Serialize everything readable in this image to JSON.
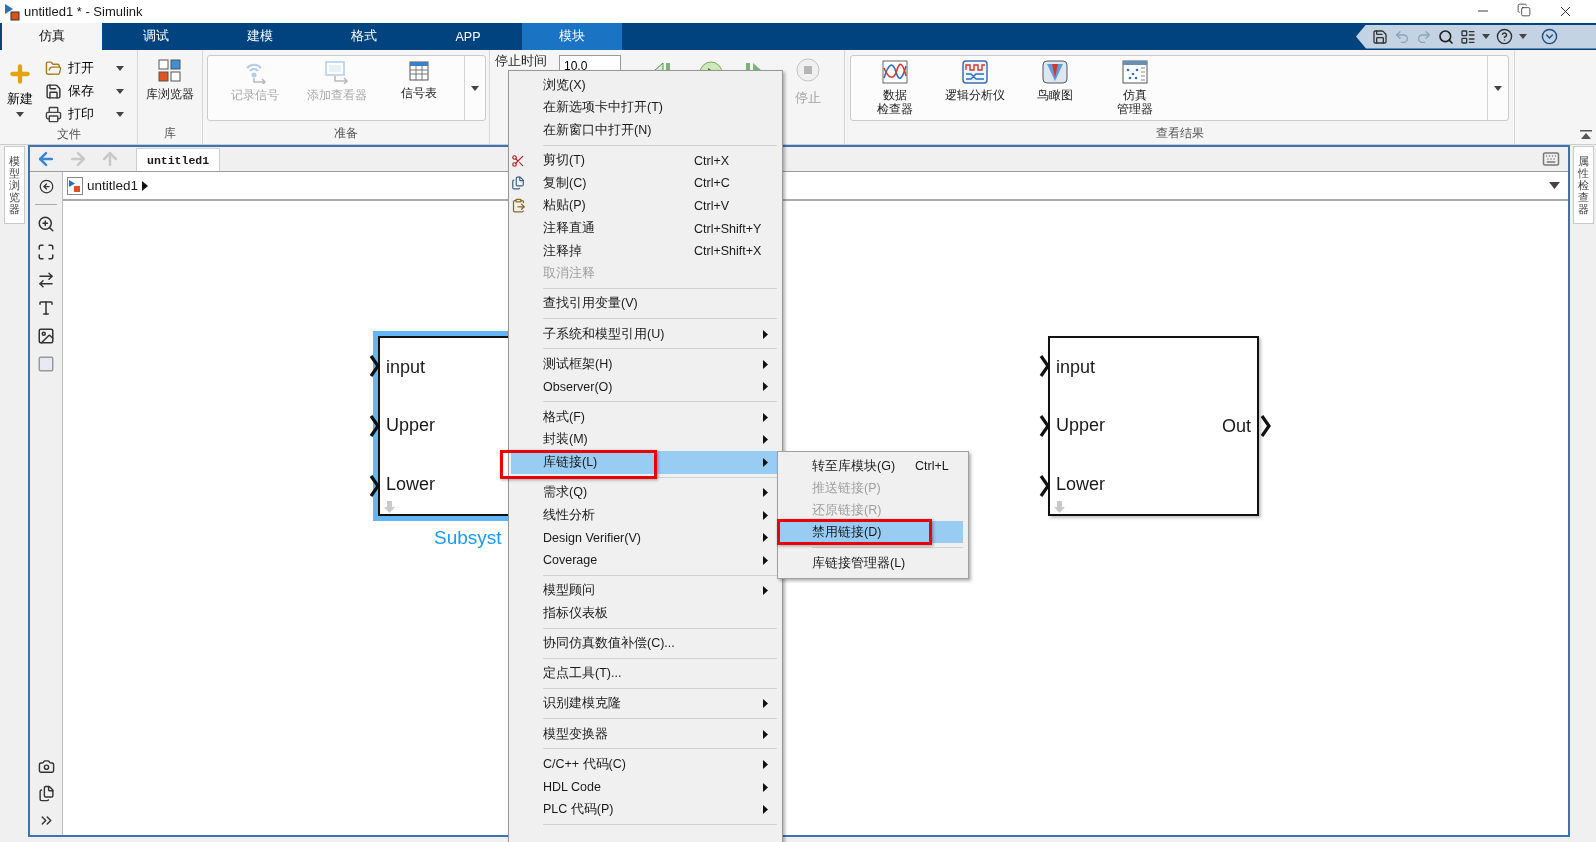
{
  "window": {
    "title": "untitled1 * - Simulink"
  },
  "ribbon_tabs": [
    {
      "label": "仿真",
      "selected": true,
      "kind": "standard"
    },
    {
      "label": "调试",
      "selected": false,
      "kind": "standard"
    },
    {
      "label": "建模",
      "selected": false,
      "kind": "standard"
    },
    {
      "label": "格式",
      "selected": false,
      "kind": "standard"
    },
    {
      "label": "APP",
      "selected": false,
      "kind": "standard"
    },
    {
      "label": "模块",
      "selected": false,
      "kind": "contextual"
    }
  ],
  "ribbon": {
    "file": {
      "title": "文件",
      "new": "新建",
      "items": [
        {
          "kind": "open",
          "label": "打开"
        },
        {
          "kind": "save",
          "label": "保存"
        },
        {
          "kind": "print",
          "label": "打印"
        }
      ]
    },
    "library": {
      "title": "库",
      "buttons": [
        {
          "kind": "library",
          "label_lines": [
            "库浏览器"
          ],
          "disabled": false
        }
      ]
    },
    "prepare": {
      "title": "准备",
      "buttons": [
        {
          "kind": "log",
          "label_lines": [
            "记录信号"
          ],
          "disabled": true
        },
        {
          "kind": "viewer",
          "label_lines": [
            "添加查看器"
          ],
          "disabled": true
        },
        {
          "kind": "table",
          "label_lines": [
            "信号表"
          ],
          "disabled": false
        }
      ]
    },
    "simulate": {
      "stop_time_label": "停止时间",
      "stop_time": "10.0",
      "stop_label": "停止",
      "stop_disabled": true
    },
    "results": {
      "title": "查看结果",
      "buttons": [
        {
          "kind": "inspector",
          "label_lines": [
            "数据",
            "检查器"
          ],
          "disabled": false
        },
        {
          "kind": "logic",
          "label_lines": [
            "逻辑分析仪"
          ],
          "disabled": false
        },
        {
          "kind": "birdseye",
          "label_lines": [
            "鸟瞰图"
          ],
          "disabled": false
        },
        {
          "kind": "manager",
          "label_lines": [
            "仿真",
            "管理器"
          ],
          "disabled": false
        }
      ]
    }
  },
  "editor": {
    "model_browser_tab": "模型浏览器",
    "property_inspector_tab": "属性检查器",
    "tab": {
      "label": "untitled1",
      "selected": true
    },
    "breadcrumb": "untitled1"
  },
  "blocks": [
    {
      "selected": true,
      "name": "Subsyst",
      "inputs": [
        "input",
        "Upper",
        "Lower"
      ]
    },
    {
      "selected": false,
      "inputs": [
        "input",
        "Upper",
        "Lower"
      ],
      "outputs": [
        "Out"
      ]
    }
  ],
  "context_menu": {
    "groups": [
      [
        {
          "kind": "plain",
          "label": "浏览(X)",
          "arrow": false,
          "disabled": false,
          "selected": false
        },
        {
          "kind": "plain",
          "label": "在新选项卡中打开(T)",
          "arrow": false,
          "disabled": false,
          "selected": false
        },
        {
          "kind": "plain",
          "label": "在新窗口中打开(N)",
          "arrow": false,
          "disabled": false,
          "selected": false
        }
      ],
      [
        {
          "kind": "cut",
          "label": "剪切(T)",
          "shortcut": "Ctrl+X",
          "arrow": false,
          "disabled": false,
          "selected": false
        },
        {
          "kind": "copy",
          "label": "复制(C)",
          "shortcut": "Ctrl+C",
          "arrow": false,
          "disabled": false,
          "selected": false
        },
        {
          "kind": "paste",
          "label": "粘贴(P)",
          "shortcut": "Ctrl+V",
          "arrow": false,
          "disabled": false,
          "selected": false
        },
        {
          "kind": "plain",
          "label": "注释直通",
          "shortcut": "Ctrl+Shift+Y",
          "arrow": false,
          "disabled": false,
          "selected": false
        },
        {
          "kind": "plain",
          "label": "注释掉",
          "shortcut": "Ctrl+Shift+X",
          "arrow": false,
          "disabled": false,
          "selected": false
        },
        {
          "kind": "plain",
          "label": "取消注释",
          "arrow": false,
          "disabled": true,
          "selected": false
        }
      ],
      [
        {
          "kind": "plain",
          "label": "查找引用变量(V)",
          "arrow": false,
          "disabled": false,
          "selected": false
        }
      ],
      [
        {
          "kind": "plain",
          "label": "子系统和模型引用(U)",
          "arrow": true,
          "disabled": false,
          "selected": false
        }
      ],
      [
        {
          "kind": "plain",
          "label": "测试框架(H)",
          "arrow": true,
          "disabled": false,
          "selected": false
        },
        {
          "kind": "plain",
          "label": "Observer(O)",
          "arrow": true,
          "disabled": false,
          "selected": false
        }
      ],
      [
        {
          "kind": "plain",
          "label": "格式(F)",
          "arrow": true,
          "disabled": false,
          "selected": false
        },
        {
          "kind": "plain",
          "label": "封装(M)",
          "arrow": true,
          "disabled": false,
          "selected": false
        },
        {
          "kind": "plain",
          "label": "库链接(L)",
          "arrow": true,
          "disabled": false,
          "selected": true,
          "boxed": true,
          "submenu": {
            "groups": [
              [
                {
                  "label": "转至库模块(G)",
                  "shortcut": "Ctrl+L",
                  "disabled": false,
                  "selected": false
                },
                {
                  "label": "推送链接(P)",
                  "disabled": true,
                  "selected": false
                },
                {
                  "label": "还原链接(R)",
                  "disabled": true,
                  "selected": false
                },
                {
                  "label": "禁用链接(D)",
                  "disabled": false,
                  "selected": true,
                  "boxed": true
                }
              ],
              [
                {
                  "label": "库链接管理器(L)",
                  "disabled": false,
                  "selected": false
                }
              ]
            ]
          }
        }
      ],
      [
        {
          "kind": "plain",
          "label": "需求(Q)",
          "arrow": true,
          "disabled": false,
          "selected": false
        },
        {
          "kind": "plain",
          "label": "线性分析",
          "arrow": true,
          "disabled": false,
          "selected": false
        },
        {
          "kind": "plain",
          "label": "Design Verifier(V)",
          "arrow": true,
          "disabled": false,
          "selected": false
        },
        {
          "kind": "plain",
          "label": "Coverage",
          "arrow": true,
          "disabled": false,
          "selected": false
        }
      ],
      [
        {
          "kind": "plain",
          "label": "模型顾问",
          "arrow": true,
          "disabled": false,
          "selected": false
        },
        {
          "kind": "plain",
          "label": "指标仪表板",
          "arrow": false,
          "disabled": false,
          "selected": false
        }
      ],
      [
        {
          "kind": "plain",
          "label": "协同仿真数值补偿(C)...",
          "arrow": false,
          "disabled": false,
          "selected": false
        }
      ],
      [
        {
          "kind": "plain",
          "label": "定点工具(T)...",
          "arrow": false,
          "disabled": false,
          "selected": false
        }
      ],
      [
        {
          "kind": "plain",
          "label": "识别建模克隆",
          "arrow": true,
          "disabled": false,
          "selected": false
        }
      ],
      [
        {
          "kind": "plain",
          "label": "模型变换器",
          "arrow": true,
          "disabled": false,
          "selected": false
        }
      ],
      [
        {
          "kind": "plain",
          "label": "C/C++ 代码(C)",
          "arrow": true,
          "disabled": false,
          "selected": false
        },
        {
          "kind": "plain",
          "label": "HDL Code",
          "arrow": true,
          "disabled": false,
          "selected": false
        },
        {
          "kind": "plain",
          "label": "PLC 代码(P)",
          "arrow": true,
          "disabled": false,
          "selected": false
        }
      ]
    ]
  }
}
